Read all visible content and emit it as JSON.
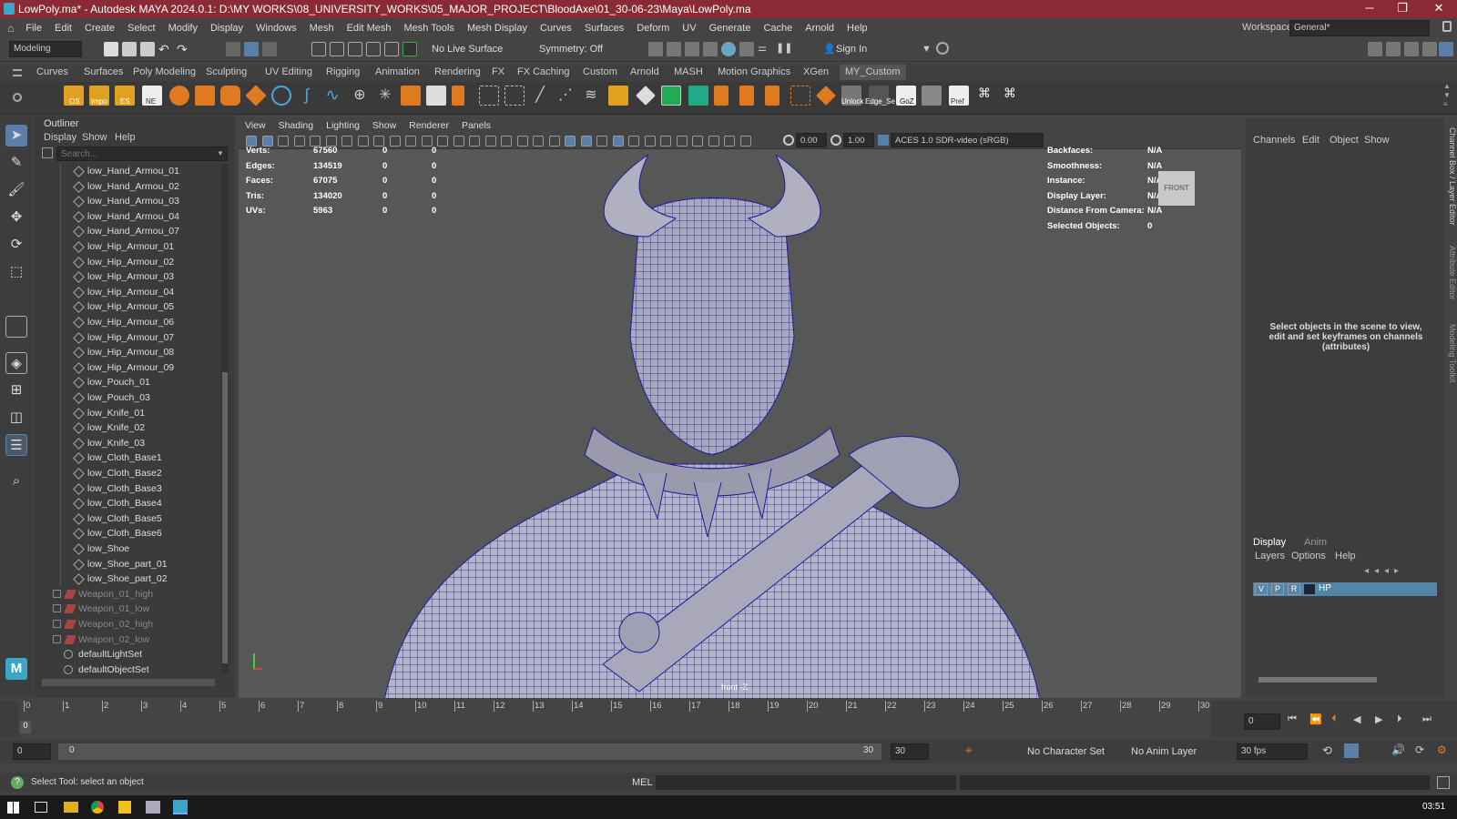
{
  "window": {
    "title": "LowPoly.ma* - Autodesk MAYA 2024.0.1: D:\\MY WORKS\\08_UNIVERSITY_WORKS\\05_MAJOR_PROJECT\\BloodAxe\\01_30-06-23\\Maya\\LowPoly.ma",
    "min": "─",
    "max": "❐",
    "close": "✕"
  },
  "menus": [
    "File",
    "Edit",
    "Create",
    "Select",
    "Modify",
    "Display",
    "Windows",
    "Mesh",
    "Edit Mesh",
    "Mesh Tools",
    "Mesh Display",
    "Curves",
    "Surfaces",
    "Deform",
    "UV",
    "Generate",
    "Cache",
    "Arnold",
    "Help"
  ],
  "workspace": {
    "label": "Workspace:",
    "value": "General*"
  },
  "status": {
    "mode": "Modeling",
    "live_surface": "No Live Surface",
    "symmetry": "Symmetry: Off",
    "sign_in": "Sign In"
  },
  "shelf_tabs": [
    "Curves",
    "Surfaces",
    "Poly Modeling",
    "Sculpting",
    "UV Editing",
    "Rigging",
    "Animation",
    "Rendering",
    "FX",
    "FX Caching",
    "Custom",
    "Arnold",
    "MASH",
    "Motion Graphics",
    "XGen",
    "MY_Custom"
  ],
  "shelf_labels": {
    "os": "OS",
    "impo": "Impo",
    "es": "ES",
    "ne": "NE",
    "unlock": "Unlock",
    "edge": "Edge_Se",
    "goz": "GoZ",
    "pref": "Pref"
  },
  "outliner": {
    "title": "Outliner",
    "menus": [
      "Display",
      "Show",
      "Help"
    ],
    "search_placeholder": "Search...",
    "items": [
      "low_Hand_Armou_01",
      "low_Hand_Armou_02",
      "low_Hand_Armou_03",
      "low_Hand_Armou_04",
      "low_Hand_Armou_07",
      "low_Hip_Armour_01",
      "low_Hip_Armour_02",
      "low_Hip_Armour_03",
      "low_Hip_Armour_04",
      "low_Hip_Armour_05",
      "low_Hip_Armour_06",
      "low_Hip_Armour_07",
      "low_Hip_Armour_08",
      "low_Hip_Armour_09",
      "low_Pouch_01",
      "low_Pouch_03",
      "low_Knife_01",
      "low_Knife_02",
      "low_Knife_03",
      "low_Cloth_Base1",
      "low_Cloth_Base2",
      "low_Cloth_Base3",
      "low_Cloth_Base4",
      "low_Cloth_Base5",
      "low_Cloth_Base6",
      "low_Shoe",
      "low_Shoe_part_01",
      "low_Shoe_part_02"
    ],
    "groups": [
      "Weapon_01_high",
      "Weapon_01_low",
      "Weapon_02_high",
      "Weapon_02_low"
    ],
    "sets": [
      "defaultLightSet",
      "defaultObjectSet"
    ]
  },
  "viewport": {
    "menus": [
      "View",
      "Shading",
      "Lighting",
      "Show",
      "Renderer",
      "Panels"
    ],
    "exposure": "0.00",
    "gamma": "1.00",
    "color_space": "ACES 1.0 SDR-video (sRGB)",
    "camera_label": "front -Z",
    "view_cube": "FRONT",
    "stats": [
      {
        "label": "Verts:",
        "v": "67560",
        "a": "0",
        "b": "0"
      },
      {
        "label": "Edges:",
        "v": "134519",
        "a": "0",
        "b": "0"
      },
      {
        "label": "Faces:",
        "v": "67075",
        "a": "0",
        "b": "0"
      },
      {
        "label": "Tris:",
        "v": "134020",
        "a": "0",
        "b": "0"
      },
      {
        "label": "UVs:",
        "v": "5963",
        "a": "0",
        "b": "0"
      }
    ],
    "info": [
      {
        "label": "Backfaces:",
        "v": "N/A"
      },
      {
        "label": "Smoothness:",
        "v": "N/A"
      },
      {
        "label": "Instance:",
        "v": "N/A"
      },
      {
        "label": "Display Layer:",
        "v": "N/A"
      },
      {
        "label": "Distance From Camera:",
        "v": "N/A"
      },
      {
        "label": "Selected Objects:",
        "v": "0"
      }
    ]
  },
  "channelbox": {
    "menus": [
      "Channels",
      "Edit",
      "Object",
      "Show"
    ],
    "message": "Select objects in the scene to view, edit and set keyframes on channels (attributes)",
    "tabs": [
      "Display",
      "Anim"
    ],
    "layer_menus": [
      "Layers",
      "Options",
      "Help"
    ],
    "layer": {
      "v": "V",
      "p": "P",
      "r": "R",
      "name": "HP"
    },
    "side_tabs": [
      "Channel Box / Layer Editor",
      "Attribute Editor",
      "Modeling Toolkit"
    ]
  },
  "timeline": {
    "ticks": [
      "0",
      "1",
      "2",
      "3",
      "4",
      "5",
      "6",
      "7",
      "8",
      "9",
      "10",
      "11",
      "12",
      "13",
      "14",
      "15",
      "16",
      "17",
      "18",
      "19",
      "20",
      "21",
      "22",
      "23",
      "24",
      "25",
      "26",
      "27",
      "28",
      "29",
      "30"
    ],
    "current": "0",
    "frame_field": "0"
  },
  "range": {
    "start": "0",
    "inner_start": "0",
    "inner_end": "30",
    "end": "30",
    "character_set": "No Character Set",
    "anim_layer": "No Anim Layer",
    "fps": "30 fps"
  },
  "cmd": {
    "help": "Select Tool: select an object",
    "lang": "MEL"
  },
  "taskbar": {
    "clock": "03:51"
  }
}
